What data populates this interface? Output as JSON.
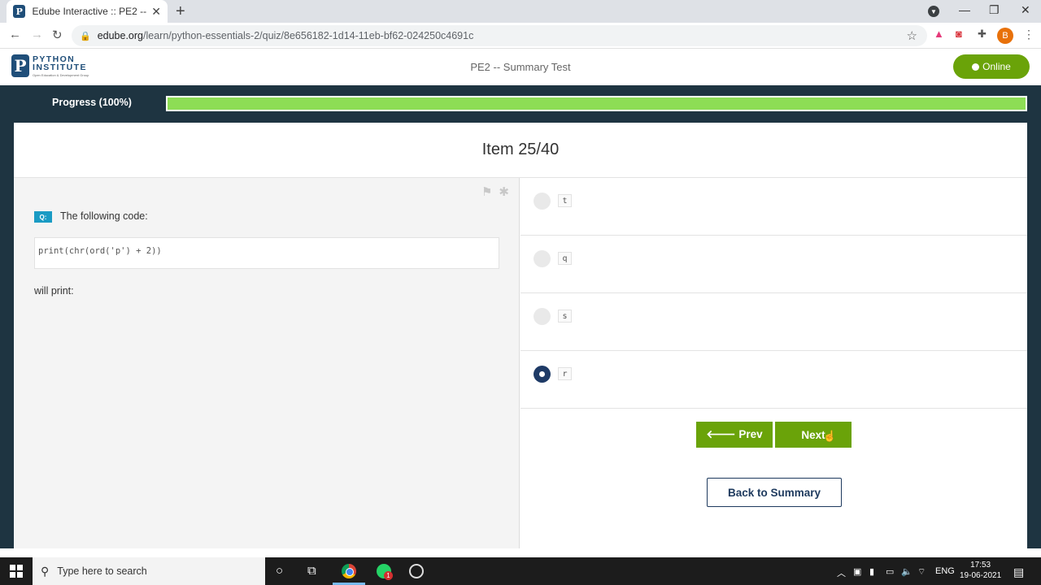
{
  "browser": {
    "tab_title": "Edube Interactive :: PE2 -- Summary Test",
    "tab_favicon_letter": "P",
    "tab_close": "✕",
    "new_tab": "+",
    "url_host": "edube.org",
    "url_path": "/learn/python-essentials-2/quiz/8e656182-1d14-11eb-bf62-024250c4691c",
    "profile_initial": "B",
    "window_controls": {
      "minimize": "—",
      "maximize": "❐",
      "close": "✕"
    }
  },
  "header": {
    "logo_line1": "PYTHON",
    "logo_line2": "INSTITUTE",
    "logo_tagline": "Open Education & Development Group",
    "logo_mark": "P",
    "page_title": "PE2 -- Summary Test",
    "status": "Online"
  },
  "progress": {
    "label": "Progress (100%)",
    "value": 1.0
  },
  "quiz": {
    "item_label": "Item 25/40",
    "question_badge": "Q:",
    "question_text": "The following code:",
    "code": "print(chr(ord('p') + 2))",
    "question_tail": "will print:",
    "answers": [
      {
        "text": "t",
        "selected": false
      },
      {
        "text": "q",
        "selected": false
      },
      {
        "text": "s",
        "selected": false
      },
      {
        "text": "r",
        "selected": true
      }
    ],
    "prev_label": "🡐 Prev",
    "next_label": "Next",
    "back_label": "Back to Summary"
  },
  "taskbar": {
    "search_placeholder": "Type here to search",
    "whatsapp_badge": "1",
    "language": "ENG",
    "time": "17:53",
    "date": "19-06-2021"
  },
  "colors": {
    "accent_green": "#6aa309",
    "progress_fill": "#8ddd55",
    "dark_band": "#1e3441",
    "navy": "#1e3a66",
    "badge_blue": "#1a9bc4"
  }
}
